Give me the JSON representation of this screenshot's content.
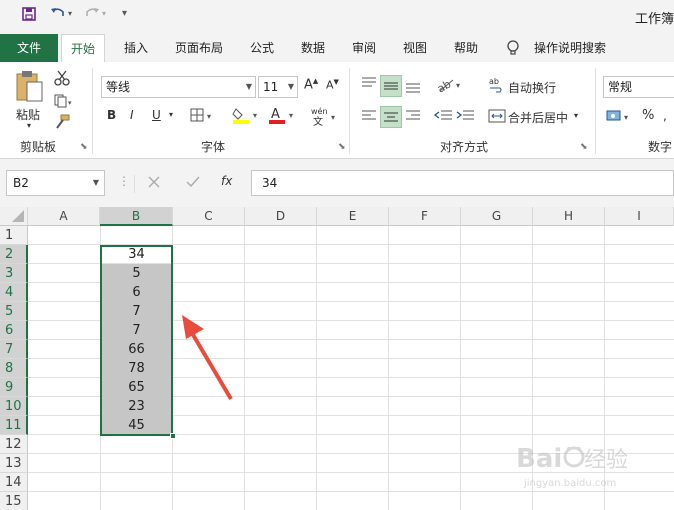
{
  "title_bar": {
    "title": "工作簿"
  },
  "tabs": [
    "文件",
    "开始",
    "插入",
    "页面布局",
    "公式",
    "数据",
    "审阅",
    "视图",
    "帮助"
  ],
  "tell_me": "操作说明搜索",
  "ribbon": {
    "clipboard": {
      "paste_label": "粘贴",
      "group_label": "剪贴板"
    },
    "font": {
      "font_name": "等线",
      "font_size": "11",
      "bold": "B",
      "italic": "I",
      "underline": "U",
      "group_label": "字体"
    },
    "alignment": {
      "wrap_text": "自动换行",
      "merge_center": "合并后居中",
      "group_label": "对齐方式"
    },
    "number": {
      "format": "常规",
      "percent": "%",
      "group_label": "数字"
    }
  },
  "formula_bar": {
    "name_box": "B2",
    "content": "34",
    "fx": "fx"
  },
  "columns": [
    "A",
    "B",
    "C",
    "D",
    "E",
    "F",
    "G",
    "H",
    "I"
  ],
  "rows": [
    "1",
    "2",
    "3",
    "4",
    "5",
    "6",
    "7",
    "8",
    "9",
    "10",
    "11",
    "12",
    "13",
    "14",
    "15"
  ],
  "column_b_values": [
    "34",
    "5",
    "6",
    "7",
    "7",
    "66",
    "78",
    "65",
    "23",
    "45"
  ],
  "colors": {
    "accent": "#217346",
    "selection_fill": "#c6c6c6",
    "arrow": "#e84c3d"
  },
  "watermark": {
    "brand": "Baidu经验",
    "url": "jingyan.baidu.com"
  }
}
